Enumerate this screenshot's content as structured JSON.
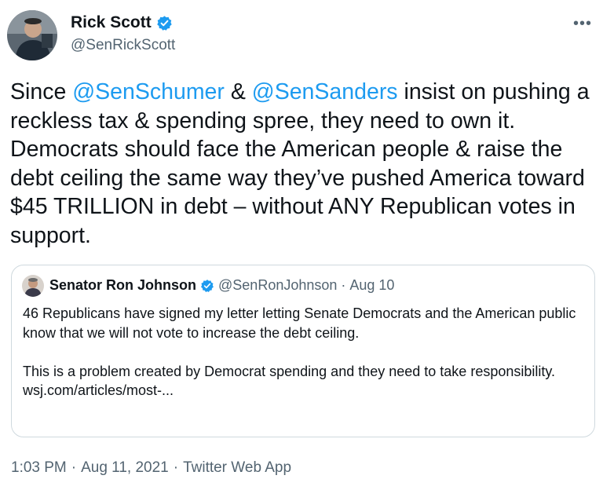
{
  "author": {
    "name": "Rick Scott",
    "handle": "@SenRickScott"
  },
  "tweet": {
    "parts": [
      {
        "text": "Since ",
        "type": "plain"
      },
      {
        "text": "@SenSchumer",
        "type": "mention"
      },
      {
        "text": " & ",
        "type": "plain"
      },
      {
        "text": "@SenSanders",
        "type": "mention"
      },
      {
        "text": " insist on pushing a reckless tax & spending spree, they need to own it. Democrats should face the American people & raise the debt ceiling the same way they’ve pushed America toward $45 TRILLION in debt – without ANY Republican votes in support.",
        "type": "plain"
      }
    ]
  },
  "quote": {
    "name": "Senator Ron Johnson",
    "handle": "@SenRonJohnson",
    "separator": "·",
    "date": "Aug 10",
    "paragraph1": "46 Republicans have signed my letter letting Senate Democrats and the American public know that we will not vote to increase the debt ceiling.",
    "paragraph2": "This is a problem created by Democrat spending and they need to take responsibility.",
    "link": "wsj.com/articles/most-..."
  },
  "meta": {
    "time": "1:03 PM",
    "separator1": "·",
    "date": "Aug 11, 2021",
    "separator2": "·",
    "source": "Twitter Web App"
  },
  "icons": {
    "more": "more-options-icon",
    "verified": "verified-badge-icon"
  },
  "colors": {
    "mention": "#1d9bf0",
    "verified": "#1d9bf0",
    "secondary_text": "#536471",
    "border": "#cfd9de"
  }
}
